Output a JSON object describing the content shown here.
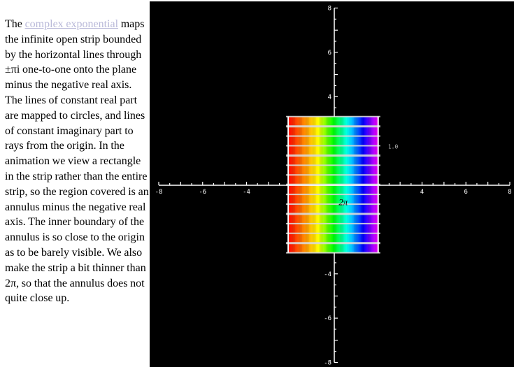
{
  "text": {
    "intro": "The ",
    "link_label": "complex exponential",
    "body": " maps the infinite open strip bounded by the horizontal lines through ±πi  one-to-one onto the plane minus the negative real axis. The lines of constant real part are mapped to circles, and lines of constant imaginary part to rays from the origin. In the animation we view a rectangle in the strip rather than the entire strip, so the region covered is an annulus minus the negative real axis. The inner boundary of the annulus is so close to the origin as to be barely visible. We also make the strip a bit thinner than 2π, so that the annulus does not quite close up."
  },
  "chart_data": {
    "type": "diagram",
    "title": "",
    "xlim": [
      -8,
      8
    ],
    "ylim": [
      -8,
      8
    ],
    "x_tick_labels": [
      "-8",
      "-6",
      "-4",
      "4",
      "6",
      "8"
    ],
    "y_tick_labels": [
      "8",
      "6",
      "4",
      "-4",
      "-6",
      "-8"
    ],
    "minor_tick_step": 0.5,
    "rectangle": {
      "x": [
        -2.1,
        2.0
      ],
      "y": [
        -3.05,
        3.1
      ]
    },
    "horizontal_lines_count": 14,
    "color_gradient": [
      "#ff0000",
      "#ff8000",
      "#ffff00",
      "#00ff00",
      "#00ffff",
      "#0000ff",
      "#ff00ff"
    ],
    "annotation": "2π",
    "parameter_label": "1.0"
  },
  "colors": {
    "background": "#000000",
    "axis": "#ffffff",
    "link": "#b8b8d8",
    "grid_line": "#d8d8d8"
  }
}
